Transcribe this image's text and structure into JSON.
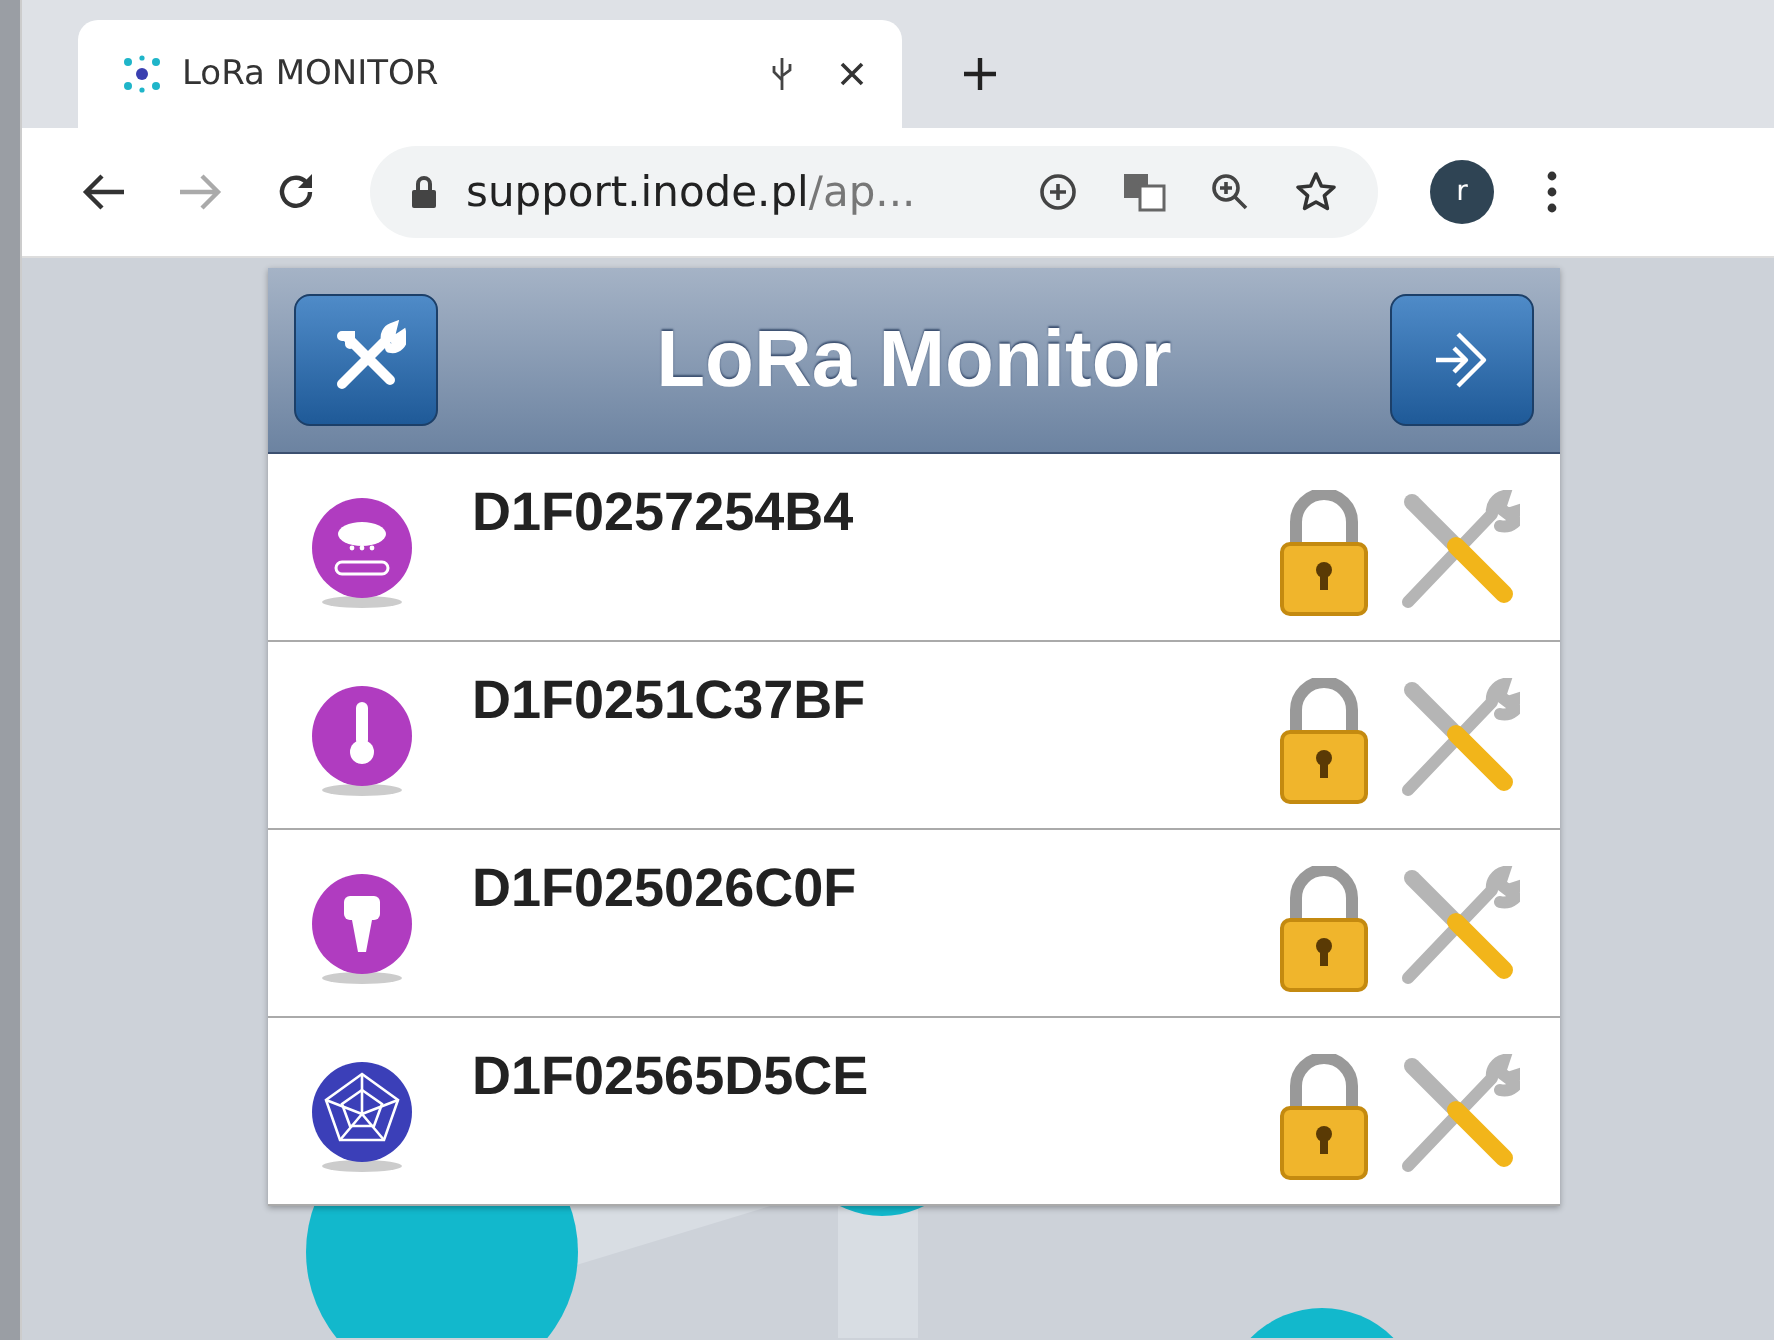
{
  "browser": {
    "tab_title": "LoRa MONITOR",
    "url_host": "support.inode.pl",
    "url_rest": "/ap...",
    "profile_initial": "r"
  },
  "app": {
    "title": "LoRa Monitor"
  },
  "devices": [
    {
      "id": "D1F0257254B4",
      "kind": "rain",
      "color": "#b03cc0"
    },
    {
      "id": "D1F0251C37BF",
      "kind": "thermometer",
      "color": "#b03cc0"
    },
    {
      "id": "D1F025026C0F",
      "kind": "plug",
      "color": "#b03cc0"
    },
    {
      "id": "D1F02565D5CE",
      "kind": "web",
      "color": "#3b3fb8"
    }
  ]
}
